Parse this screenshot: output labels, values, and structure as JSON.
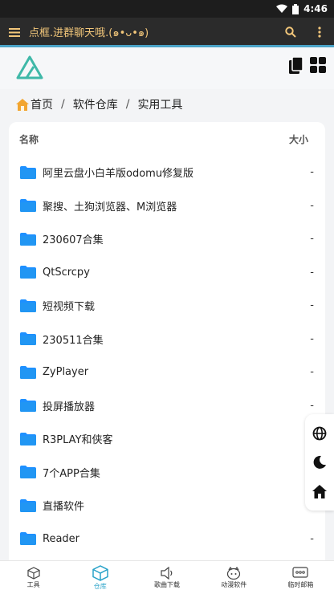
{
  "status": {
    "time": "4:46"
  },
  "appbar": {
    "title": "点框.进群聊天哦.(๑•ᴗ•๑)"
  },
  "breadcrumb": {
    "items": [
      "首页",
      "软件仓库",
      "实用工具"
    ]
  },
  "list": {
    "col_name": "名称",
    "col_size": "大小",
    "rows": [
      {
        "name": "阿里云盘小白羊版odomu修复版",
        "size": "-"
      },
      {
        "name": "聚搜、土狗浏览器、M浏览器",
        "size": "-"
      },
      {
        "name": "230607合集",
        "size": "-"
      },
      {
        "name": "QtScrcpy",
        "size": "-"
      },
      {
        "name": "短视频下载",
        "size": "-"
      },
      {
        "name": "230511合集",
        "size": "-"
      },
      {
        "name": "ZyPlayer",
        "size": "-"
      },
      {
        "name": "投屏播放器",
        "size": "-"
      },
      {
        "name": "R3PLAY和侠客",
        "size": "-"
      },
      {
        "name": "7个APP合集",
        "size": "-"
      },
      {
        "name": "直播软件",
        "size": "-"
      },
      {
        "name": "Reader",
        "size": "-"
      }
    ]
  },
  "bottomnav": {
    "items": [
      {
        "label": "工具"
      },
      {
        "label": "仓库"
      },
      {
        "label": "歌曲下载"
      },
      {
        "label": "动漫软件"
      },
      {
        "label": "临时邮箱"
      }
    ]
  },
  "colors": {
    "accent": "#2aa3c9",
    "folder": "#1e90ff",
    "appbar_text": "#f3c77a"
  }
}
